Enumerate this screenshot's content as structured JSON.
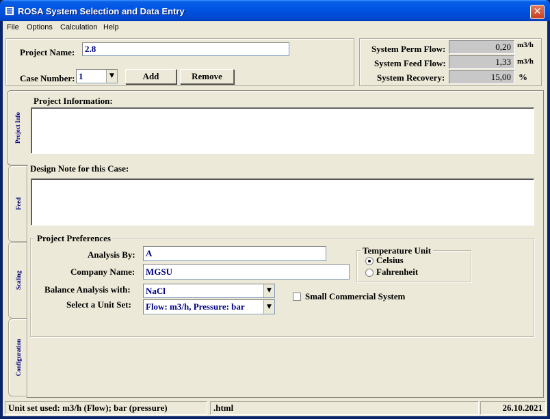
{
  "window": {
    "title": "ROSA System Selection and Data Entry",
    "close_glyph": "✕"
  },
  "menu": [
    "File",
    "Options",
    "Calculation",
    "Help"
  ],
  "project": {
    "name_label": "Project Name:",
    "name_value": "2.8",
    "case_label": "Case Number:",
    "case_value": "1",
    "add_label": "Add",
    "remove_label": "Remove"
  },
  "system": {
    "perm_flow_label": "System Perm Flow:",
    "perm_flow_value": "0,20",
    "perm_flow_unit": "m3/h",
    "feed_flow_label": "System Feed Flow:",
    "feed_flow_value": "1,33",
    "feed_flow_unit": "m3/h",
    "recovery_label": "System Recovery:",
    "recovery_value": "15,00",
    "recovery_unit": "%"
  },
  "tabs": [
    "Project Info",
    "Feed",
    "Scaling",
    "Configuration"
  ],
  "info": {
    "project_info_label": "Project Information:",
    "design_note_label": "Design Note for this Case:"
  },
  "prefs": {
    "group_label": "Project Preferences",
    "analysis_by_label": "Analysis By:",
    "analysis_by_value": "A",
    "company_label": "Company Name:",
    "company_value": "MGSU",
    "balance_label": "Balance Analysis with:",
    "balance_value": "NaCl",
    "unit_set_label": "Select a Unit Set:",
    "unit_set_value": "Flow: m3/h, Pressure: bar",
    "temp_group_label": "Temperature Unit",
    "celsius_label": "Celsius",
    "fahrenheit_label": "Fahrenheit",
    "small_commercial_label": "Small Commercial System"
  },
  "status": {
    "unit_text": "Unit set used: m3/h (Flow); bar (pressure)",
    "file_text": ".html",
    "date_text": "26.10.2021"
  }
}
